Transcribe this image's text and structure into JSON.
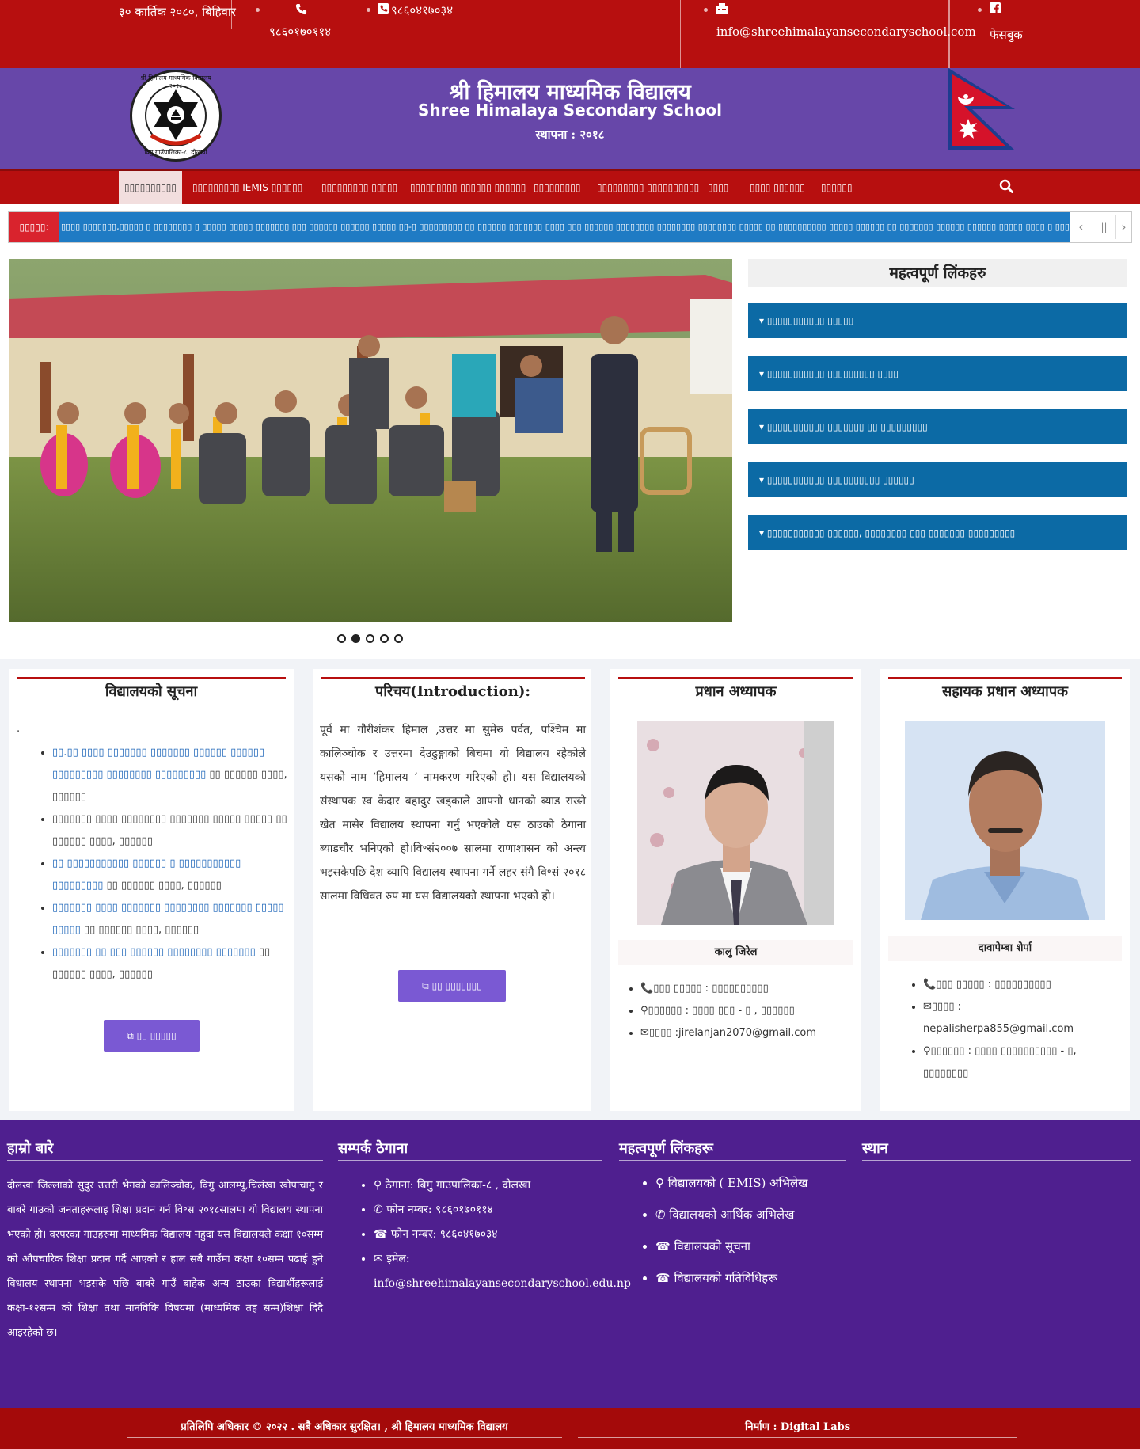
{
  "topbar": {
    "date": "३० कार्तिक २०८०, बिहिवार",
    "phone1": "९८६०१७०११४",
    "phone2": "९८६०४१७०३४",
    "email": "info@shreehimalayansecondaryschool.com",
    "facebook": "फेसबुक"
  },
  "header": {
    "title_np": "श्री हिमालय माध्यमिक विद्यालय",
    "title_en": "Shree Himalaya Secondary School",
    "established": "स्थापना : २०१८",
    "logo_top_text": "श्री हिमालय माध्यमिक विद्यालय",
    "logo_year": "२०१८",
    "logo_bottom_text": "विगु गाउँपालिका-८, दोलखा"
  },
  "nav": {
    "items": [
      "▯▯▯▯▯▯▯▯▯▯",
      "▯▯▯▯▯▯▯▯▯ IEMIS ▯▯▯▯▯▯",
      "▯▯▯▯▯▯▯▯▯ ▯▯▯▯▯",
      "▯▯▯▯▯▯▯▯▯ ▯▯▯▯▯▯ ▯▯▯▯▯▯",
      "▯▯▯▯▯▯▯▯▯",
      "▯▯▯▯▯▯▯▯▯ ▯▯▯▯▯▯▯▯▯▯",
      "▯▯▯▯",
      "▯▯▯▯ ▯▯▯▯▯▯",
      "▯▯▯▯▯▯"
    ],
    "search_icon": "search-icon"
  },
  "ticker": {
    "label": "▯▯▯▯▯:",
    "text": "▯▯▯▯ ▯▯▯▯▯▯▯,▯▯▯▯▯ ▯ ▯▯▯▯▯▯▯▯ ▯ ▯▯▯▯▯ ▯▯▯▯▯ ▯▯▯▯▯▯▯ ▯▯▯ ▯▯▯▯▯▯ ▯▯▯▯▯▯ ▯▯▯▯▯ ▯▯-▯ ▯▯▯▯▯▯▯▯▯ ▯▯ ▯▯▯▯▯▯ ▯▯▯▯▯▯▯ ▯▯▯▯ ▯▯▯ ▯▯▯▯▯▯ ▯▯▯▯▯▯▯▯ ▯▯▯▯▯▯▯▯ ▯▯▯▯▯▯▯▯ ▯▯▯▯▯ ▯▯ ▯▯▯▯▯▯▯▯▯▯ ▯▯▯▯▯ ▯▯▯▯▯▯ ▯▯ ▯▯▯▯▯▯▯ ▯▯▯▯▯▯ ▯▯▯▯▯▯ ▯▯▯▯▯ ▯▯▯▯ ▯ ▯▯▯ ▯▯▯"
  },
  "slider": {
    "dots": 5,
    "active_dot": 1
  },
  "important_links": {
    "title": "महत्वपूर्ण लिंकहरु",
    "items": [
      "▯▯▯▯▯▯▯▯▯▯▯ ▯▯▯▯▯",
      "▯▯▯▯▯▯▯▯▯▯▯ ▯▯▯▯▯▯▯▯▯ ▯▯▯▯",
      "▯▯▯▯▯▯▯▯▯▯▯ ▯▯▯▯▯▯▯ ▯▯ ▯▯▯▯▯▯▯▯▯",
      "▯▯▯▯▯▯▯▯▯▯▯ ▯▯▯▯▯▯▯▯▯▯ ▯▯▯▯▯▯",
      "▯▯▯▯▯▯▯▯▯▯▯ ▯▯▯▯▯▯, ▯▯▯▯▯▯▯▯ ▯▯▯ ▯▯▯▯▯▯▯ ▯▯▯▯▯▯▯▯▯"
    ]
  },
  "notice": {
    "title": "विद्यालयको सूचना",
    "dot": ".",
    "items": [
      {
        "link": "▯▯.▯▯ ▯▯▯▯ ▯▯▯▯▯▯▯ ▯▯▯▯▯▯▯ ▯▯▯▯▯▯ ▯▯▯▯▯▯ ▯▯▯▯▯▯▯▯▯ ▯▯▯▯▯▯▯▯ ▯▯▯▯▯▯▯▯▯",
        "meta": " ▯▯ ▯▯▯▯▯▯ ▯▯▯▯, ▯▯▯▯▯▯"
      },
      {
        "link": "",
        "meta": "▯▯▯▯▯▯▯ ▯▯▯▯ ▯▯▯▯▯▯▯▯ ▯▯▯▯▯▯▯ ▯▯▯▯▯ ▯▯▯▯▯ ▯▯ ▯▯▯▯▯▯ ▯▯▯▯, ▯▯▯▯▯▯"
      },
      {
        "link": "▯▯ ▯▯▯▯▯▯▯▯▯▯▯ ▯▯▯▯▯▯ ▯ ▯▯▯▯▯▯▯▯▯▯▯ ▯▯▯▯▯▯▯▯▯",
        "meta": " ▯▯ ▯▯▯▯▯▯ ▯▯▯▯, ▯▯▯▯▯▯"
      },
      {
        "link": "▯▯▯▯▯▯▯ ▯▯▯▯ ▯▯▯▯▯▯▯ ▯▯▯▯▯▯▯▯ ▯▯▯▯▯▯▯ ▯▯▯▯▯ ▯▯▯▯▯",
        "meta": " ▯▯ ▯▯▯▯▯▯ ▯▯▯▯, ▯▯▯▯▯▯"
      },
      {
        "link": "▯▯▯▯▯▯▯ ▯▯ ▯▯▯ ▯▯▯▯▯▯ ▯▯▯▯▯▯▯▯ ▯▯▯▯▯▯▯",
        "meta": " ▯▯ ▯▯▯▯▯▯ ▯▯▯▯, ▯▯▯▯▯▯"
      }
    ],
    "button": "▯▯ ▯▯▯▯▯"
  },
  "intro": {
    "title": "परिचय(Introduction):",
    "text": "पूर्व मा गौरीशंकर हिमाल ,उत्तर मा सुमेरु पर्वत,  पश्चिम मा कालिञ्चोक र उत्तरमा देउढुङ्गाको बिचमा यो बिद्यालय रहेकोले यसको नाम ‘हिमालय ‘ नामकरण गरिएको हो। यस विद्यालयको संस्थापक स्व केदार बहादुर खड्काले आफ्नो धानको ब्याड राख्ने खेत मासेर विद्यालय स्थापना गर्नु भएकोले यस ठाउको ठेगाना ब्याडचौर भनिएको हो।वि॰सं२००७ सालमा राणाशासन को अन्त्य भइसकेपछि देश व्यापि विद्यालय स्थापना गर्ने लहर संगै वि॰सं २०१८ सालमा विधिवत रुप मा यस विद्यालयको स्थापना भएको हो।",
    "button": "▯▯ ▯▯▯▯▯▯▯"
  },
  "principal": {
    "title": "प्रधान अध्यापक",
    "name": "कालु जिरेल",
    "phone": "▯▯▯ ▯▯▯▯▯ : ▯▯▯▯▯▯▯▯▯▯",
    "address": "▯▯▯▯▯▯ : ▯▯▯▯ ▯▯▯ - ▯ , ▯▯▯▯▯▯",
    "email": "▯▯▯▯ :jirelanjan2070@gmail.com"
  },
  "vice_principal": {
    "title": "सहायक प्रधान अध्यापक",
    "name": "दावापेम्बा शेर्पा",
    "phone": "▯▯▯ ▯▯▯▯▯ : ▯▯▯▯▯▯▯▯▯▯",
    "email_label": "▯▯▯▯ :",
    "email": "nepalisherpa855@gmail.com",
    "address": "▯▯▯▯▯▯ : ▯▯▯▯ ▯▯▯▯▯▯▯▯▯▯ - ▯,",
    "address2": "▯▯▯▯▯▯▯▯"
  },
  "footer": {
    "about_title": "हाम्रो बारे",
    "about_text": "दोलखा जिल्लाको सुदुर उत्तरी भेगको कालिञ्चोक, विगु आलम्पु,चिलंखा खोपाचागु र बाबरे गाउको जनताहरूलाइ शिक्षा प्रदान गर्न वि॰स २०१८सालमा यो विद्यालय स्थापना भएको हो। वरपरका गाउहरुमा माध्यमिक विद्यालय नहुदा यस विद्यालयले कक्षा १०सम्म को औपचारिक शिक्षा प्रदान गर्दै आएको र हाल सबै गाउँमा कक्षा १०सम्म पढाई हुने विधालय स्थापना भइसके पछि बाबरे गाउँ बाहेक अन्य ठाउका विद्यार्थीहरूलाई कक्षा-१२सम्म को शिक्षा तथा मानविकि विषयमा (माध्यमिक तह सम्म)शिक्षा दिदै आइरहेको छ।",
    "contact_title": "सम्पर्क ठेगाना",
    "contact_items": [
      "ठेगाना: बिगु गाउपालिका-८ , दोलखा",
      "फोन नम्बर: ९८६०१७०११४",
      "फोन नम्बर: ९८६०४१७०३४",
      "इमेल:",
      "info@shreehimalayansecondaryschool.edu.np"
    ],
    "links_title": "महत्वपूर्ण लिंकहरू",
    "links_items": [
      "विद्यालयको ( EMIS) अभिलेख",
      "विद्यालयको आर्थिक अभिलेख",
      "विद्यालयको सूचना",
      "विद्यालयको गतिविधिहरू"
    ],
    "location_title": "स्थान"
  },
  "bottom": {
    "copyright": "प्रतिलिपि अधिकार © २०२२ . सबै अधिकार सुरक्षित। , श्री हिमालय माध्यमिक विद्यालय",
    "made_by": "निर्माण : Digital Labs"
  },
  "colors": {
    "topbar_red": "#b70f0f",
    "header_purple": "#6747a9",
    "link_blue": "#0c6aa5",
    "footer_purple": "#4f1f8f",
    "button_purple": "#7a59d3"
  }
}
